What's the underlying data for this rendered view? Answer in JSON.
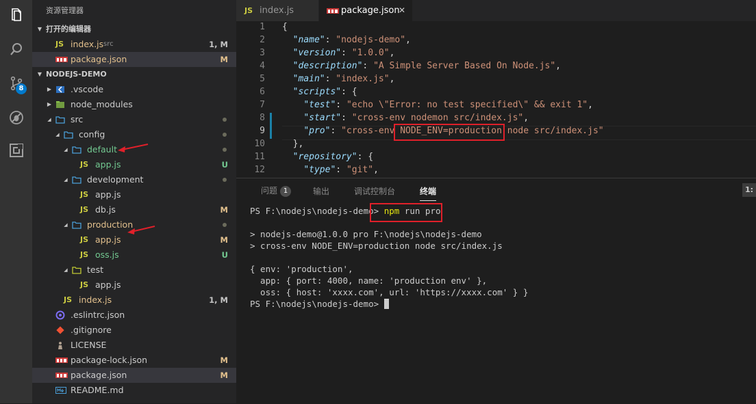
{
  "activity": {
    "explorer": "explorer-icon",
    "search": "search-icon",
    "scm": "source-control-icon",
    "scm_badge": "8",
    "debug": "debug-icon",
    "extensions": "extensions-icon"
  },
  "sidebar": {
    "title": "资源管理器",
    "open_editors_header": "打开的编辑器",
    "open_editors": [
      {
        "icon": "JS",
        "name": "index.js",
        "path": "src",
        "status": "1, M"
      },
      {
        "icon": "npm",
        "name": "package.json",
        "path": "",
        "status": "M"
      }
    ],
    "project_header": "NODEJS-DEMO",
    "tree": [
      {
        "name": ".vscode",
        "status": ""
      },
      {
        "name": "node_modules",
        "status": ""
      },
      {
        "name": "src",
        "status": "•"
      },
      {
        "name": "config",
        "status": "•"
      },
      {
        "name": "default",
        "status": "•"
      },
      {
        "name": "app.js",
        "status": "U"
      },
      {
        "name": "development",
        "status": "•"
      },
      {
        "name": "app.js",
        "status": ""
      },
      {
        "name": "db.js",
        "status": "M"
      },
      {
        "name": "production",
        "status": "•"
      },
      {
        "name": "app.js",
        "status": "M"
      },
      {
        "name": "oss.js",
        "status": "U"
      },
      {
        "name": "test",
        "status": ""
      },
      {
        "name": "app.js",
        "status": ""
      },
      {
        "name": "index.js",
        "status": "1, M"
      },
      {
        "name": ".eslintrc.json",
        "status": ""
      },
      {
        "name": ".gitignore",
        "status": ""
      },
      {
        "name": "LICENSE",
        "status": ""
      },
      {
        "name": "package-lock.json",
        "status": "M"
      },
      {
        "name": "package.json",
        "status": "M"
      },
      {
        "name": "README.md",
        "status": ""
      }
    ]
  },
  "tabs": [
    {
      "icon": "JS",
      "label": "index.js"
    },
    {
      "icon": "npm",
      "label": "package.json",
      "close": "✕"
    }
  ],
  "editor": {
    "line_numbers": [
      "1",
      "2",
      "3",
      "4",
      "5",
      "6",
      "7",
      "8",
      "9",
      "10",
      "11",
      "12"
    ],
    "lines": [
      [
        {
          "c": "p",
          "t": "{"
        }
      ],
      [
        {
          "c": "p",
          "t": "  "
        },
        {
          "c": "k",
          "t": "\"name\""
        },
        {
          "c": "p",
          "t": ": "
        },
        {
          "c": "s",
          "t": "\"nodejs-demo\""
        },
        {
          "c": "p",
          "t": ","
        }
      ],
      [
        {
          "c": "p",
          "t": "  "
        },
        {
          "c": "k",
          "t": "\"version\""
        },
        {
          "c": "p",
          "t": ": "
        },
        {
          "c": "s",
          "t": "\"1.0.0\""
        },
        {
          "c": "p",
          "t": ","
        }
      ],
      [
        {
          "c": "p",
          "t": "  "
        },
        {
          "c": "k",
          "t": "\"description\""
        },
        {
          "c": "p",
          "t": ": "
        },
        {
          "c": "s",
          "t": "\"A Simple Server Based On Node.js\""
        },
        {
          "c": "p",
          "t": ","
        }
      ],
      [
        {
          "c": "p",
          "t": "  "
        },
        {
          "c": "k",
          "t": "\"main\""
        },
        {
          "c": "p",
          "t": ": "
        },
        {
          "c": "s",
          "t": "\"index.js\""
        },
        {
          "c": "p",
          "t": ","
        }
      ],
      [
        {
          "c": "p",
          "t": "  "
        },
        {
          "c": "k",
          "t": "\"scripts\""
        },
        {
          "c": "p",
          "t": ": {"
        }
      ],
      [
        {
          "c": "p",
          "t": "    "
        },
        {
          "c": "k",
          "t": "\"test\""
        },
        {
          "c": "p",
          "t": ": "
        },
        {
          "c": "s",
          "t": "\"echo \\\"Error: no test specified\\\" && exit 1\""
        },
        {
          "c": "p",
          "t": ","
        }
      ],
      [
        {
          "c": "p",
          "t": "    "
        },
        {
          "c": "k",
          "t": "\"start\""
        },
        {
          "c": "p",
          "t": ": "
        },
        {
          "c": "s",
          "t": "\"cross-env nodemon src/index.js\""
        },
        {
          "c": "p",
          "t": ","
        }
      ],
      [
        {
          "c": "p",
          "t": "    "
        },
        {
          "c": "k",
          "t": "\"pro\""
        },
        {
          "c": "p",
          "t": ": "
        },
        {
          "c": "s",
          "t": "\"cross-env NODE_ENV=production node src/index.js\""
        }
      ],
      [
        {
          "c": "p",
          "t": "  },"
        }
      ],
      [
        {
          "c": "p",
          "t": "  "
        },
        {
          "c": "k",
          "t": "\"repository\""
        },
        {
          "c": "p",
          "t": ": {"
        }
      ],
      [
        {
          "c": "p",
          "t": "    "
        },
        {
          "c": "k",
          "t": "\"type\""
        },
        {
          "c": "p",
          "t": ": "
        },
        {
          "c": "s",
          "t": "\"git\""
        },
        {
          "c": "p",
          "t": ","
        }
      ]
    ]
  },
  "panel": {
    "tabs": [
      {
        "label": "问题",
        "badge": "1"
      },
      {
        "label": "输出"
      },
      {
        "label": "调试控制台"
      },
      {
        "label": "终端"
      }
    ],
    "right_label": "1:",
    "terminal": {
      "prompt": "PS F:\\nodejs\\nodejs-demo>",
      "command_cmd": "npm",
      "command_args": " run pro",
      "out1": "> nodejs-demo@1.0.0 pro F:\\nodejs\\nodejs-demo",
      "out2": "> cross-env NODE_ENV=production node src/index.js",
      "out3": "{ env: 'production',",
      "out4": "  app: { port: 4000, name: 'production env' },",
      "out5": "  oss: { host: 'xxxx.com', url: 'https://xxxx.com' } }",
      "prompt2": "PS F:\\nodejs\\nodejs-demo>"
    }
  },
  "colors": {
    "accent": "#007acc",
    "highlight_box": "#e0202a",
    "modified": "#e2c08d",
    "untracked": "#73c991"
  }
}
